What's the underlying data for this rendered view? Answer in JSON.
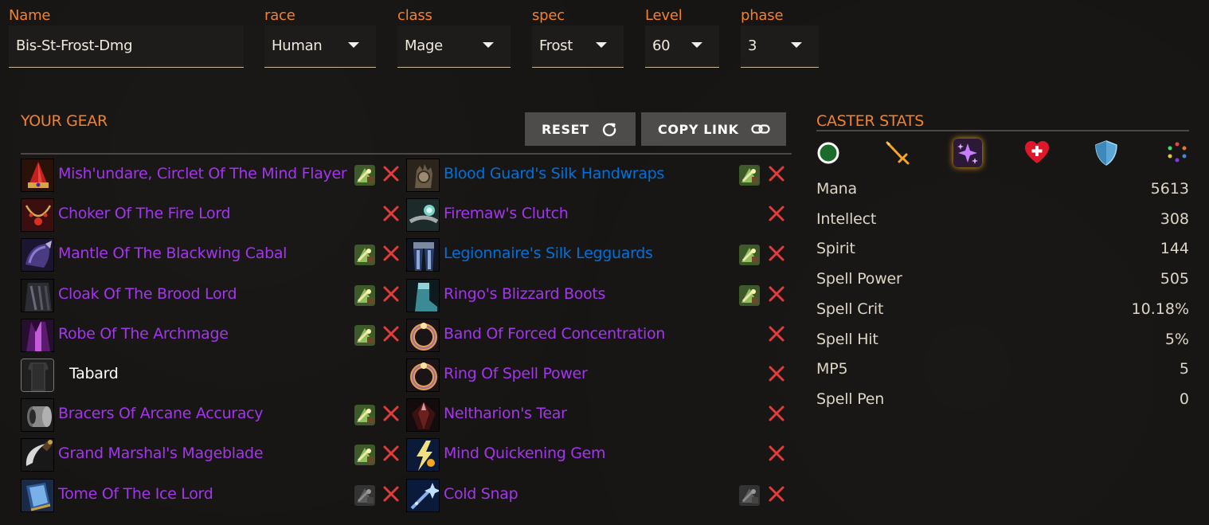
{
  "selectors": {
    "name": {
      "label": "Name",
      "value": "Bis-St-Frost-Dmg"
    },
    "race": {
      "label": "race",
      "value": "Human"
    },
    "class": {
      "label": "class",
      "value": "Mage"
    },
    "spec": {
      "label": "spec",
      "value": "Frost"
    },
    "level": {
      "label": "Level",
      "value": "60"
    },
    "phase": {
      "label": "phase",
      "value": "3"
    }
  },
  "gear": {
    "title": "YOUR GEAR",
    "reset_label": "RESET",
    "copy_link_label": "COPY LINK",
    "left": [
      {
        "name": "Mish'undare, Circlet Of The Mind Flayer",
        "quality": "epic",
        "icon": "helm-icon",
        "enchant": "active"
      },
      {
        "name": "Choker Of The Fire Lord",
        "quality": "epic",
        "icon": "necklace-icon",
        "enchant": "none"
      },
      {
        "name": "Mantle Of The Blackwing Cabal",
        "quality": "epic",
        "icon": "shoulder-icon",
        "enchant": "active"
      },
      {
        "name": "Cloak Of The Brood Lord",
        "quality": "epic",
        "icon": "cloak-icon",
        "enchant": "active"
      },
      {
        "name": "Robe Of The Archmage",
        "quality": "epic",
        "icon": "robe-icon",
        "enchant": "active"
      },
      {
        "name": "Tabard",
        "quality": "plain",
        "icon": "tabard-icon",
        "enchant": "hidden"
      },
      {
        "name": "Bracers Of Arcane Accuracy",
        "quality": "epic",
        "icon": "bracers-icon",
        "enchant": "active"
      },
      {
        "name": "Grand Marshal's Mageblade",
        "quality": "epic",
        "icon": "dagger-icon",
        "enchant": "active"
      },
      {
        "name": "Tome Of The Ice Lord",
        "quality": "epic",
        "icon": "book-icon",
        "enchant": "inactive"
      }
    ],
    "right": [
      {
        "name": "Blood Guard's Silk Handwraps",
        "quality": "rare",
        "icon": "gloves-icon",
        "enchant": "active"
      },
      {
        "name": "Firemaw's Clutch",
        "quality": "epic",
        "icon": "belt-icon",
        "enchant": "none"
      },
      {
        "name": "Legionnaire's Silk Legguards",
        "quality": "rare",
        "icon": "legs-icon",
        "enchant": "active"
      },
      {
        "name": "Ringo's Blizzard Boots",
        "quality": "epic",
        "icon": "boots-icon",
        "enchant": "active"
      },
      {
        "name": "Band Of Forced Concentration",
        "quality": "epic",
        "icon": "ring-icon",
        "enchant": "none"
      },
      {
        "name": "Ring Of Spell Power",
        "quality": "epic",
        "icon": "ring-icon",
        "enchant": "none"
      },
      {
        "name": "Neltharion's Tear",
        "quality": "epic",
        "icon": "gem-icon",
        "enchant": "none"
      },
      {
        "name": "Mind Quickening Gem",
        "quality": "epic",
        "icon": "lightning-icon",
        "enchant": "none"
      },
      {
        "name": "Cold Snap",
        "quality": "epic",
        "icon": "wand-icon",
        "enchant": "inactive"
      }
    ]
  },
  "stats": {
    "title": "CASTER STATS",
    "tabs": [
      "circle-icon",
      "sword-icon",
      "sparkle-icon",
      "heart-icon",
      "shield-icon",
      "gems-icon"
    ],
    "active_tab": "sparkle-icon",
    "rows": [
      {
        "name": "Mana",
        "value": "5613"
      },
      {
        "name": "Intellect",
        "value": "308"
      },
      {
        "name": "Spirit",
        "value": "144"
      },
      {
        "name": "Spell Power",
        "value": "505"
      },
      {
        "name": "Spell Crit",
        "value": "10.18%"
      },
      {
        "name": "Spell Hit",
        "value": "5%"
      },
      {
        "name": "MP5",
        "value": "5"
      },
      {
        "name": "Spell Pen",
        "value": "0"
      }
    ]
  },
  "colors": {
    "accent": "#f0822e",
    "epic": "#a335ee",
    "rare": "#0070dd",
    "remove": "#e23b3b"
  }
}
